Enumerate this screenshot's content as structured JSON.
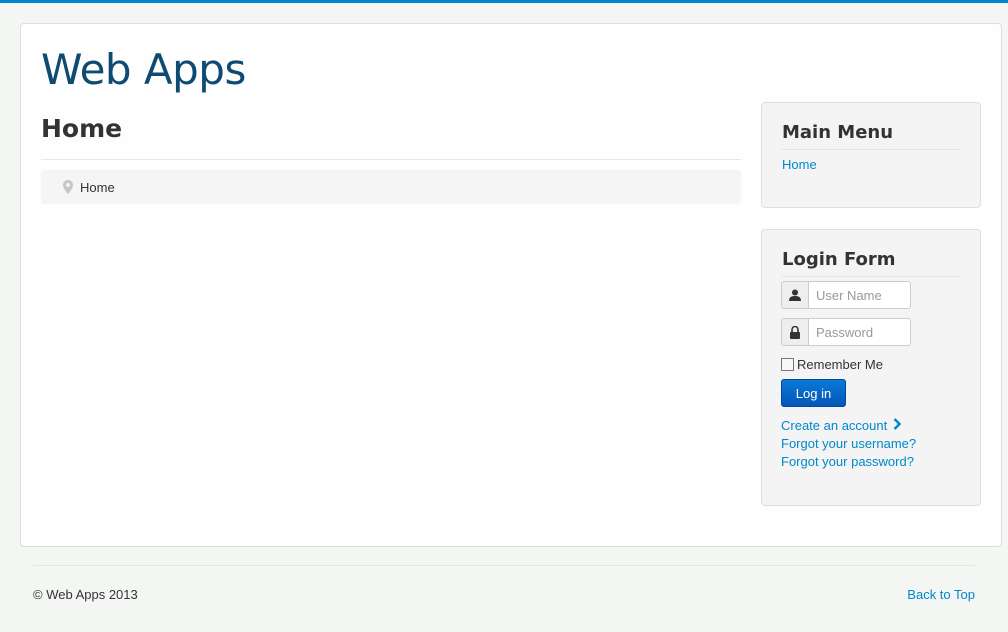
{
  "site": {
    "title": "Web Apps"
  },
  "main": {
    "page_title": "Home",
    "breadcrumb": {
      "icon": "map-pin-icon",
      "items": [
        "Home"
      ]
    }
  },
  "sidebar": {
    "main_menu": {
      "title": "Main Menu",
      "items": [
        {
          "label": "Home"
        }
      ]
    },
    "login_form": {
      "title": "Login Form",
      "username": {
        "placeholder": "User Name",
        "value": "",
        "icon": "user-icon"
      },
      "password": {
        "placeholder": "Password",
        "value": "",
        "icon": "lock-icon"
      },
      "remember_label": "Remember Me",
      "remember_checked": false,
      "login_label": "Log in",
      "create_account": "Create an account",
      "forgot_username": "Forgot your username?",
      "forgot_password": "Forgot your password?"
    }
  },
  "footer": {
    "copyright": "© Web Apps 2013",
    "back_to_top": "Back to Top"
  },
  "colors": {
    "accent": "#0088cc",
    "title": "#0e4a72",
    "button": "#0556b8"
  }
}
